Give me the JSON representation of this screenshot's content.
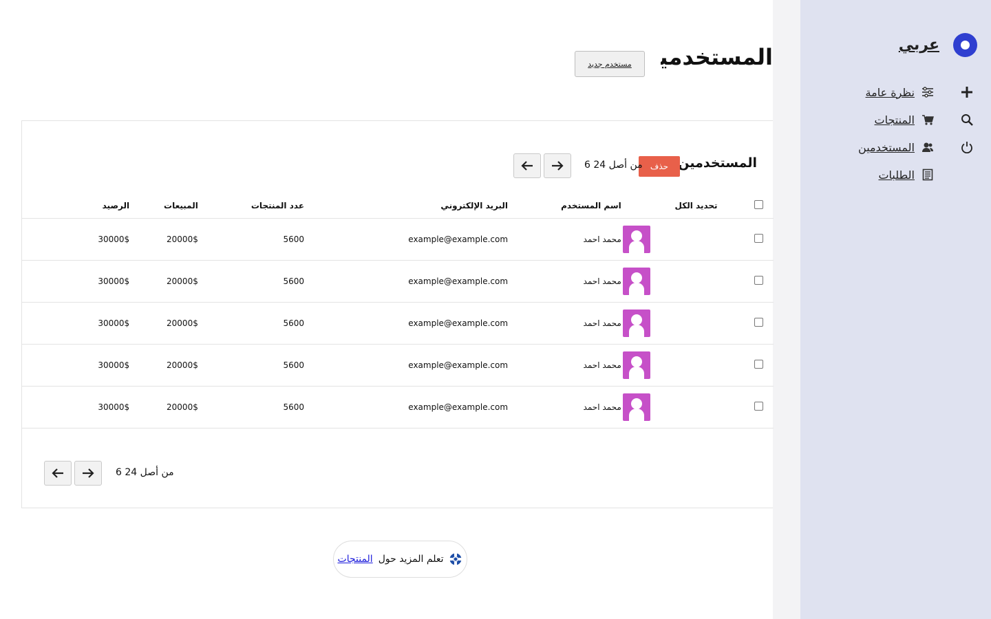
{
  "brand": {
    "name": "عربي",
    "accent": "#2f3fd0"
  },
  "sidebar": {
    "items": [
      {
        "label": "نظرة عامة",
        "icon": "sliders-icon"
      },
      {
        "label": "المنتجات",
        "icon": "cart-icon"
      },
      {
        "label": "المستخدمين",
        "icon": "users-icon"
      },
      {
        "label": "الطلبات",
        "icon": "document-icon"
      }
    ],
    "actions": [
      "plus-icon",
      "search-icon",
      "power-icon"
    ]
  },
  "header": {
    "title": "المستخدمين",
    "new_user_label": "مستخدم جديد"
  },
  "card": {
    "title": "المستخدمين",
    "delete_label": "حذف",
    "pager_text": "6 من أصل 24"
  },
  "table": {
    "headers": {
      "select_all": "تحديد الكل",
      "username": "اسم المستخدم",
      "email": "البريد الإلكتروني",
      "products": "عدد المنتجات",
      "sales": "المبيعات",
      "balance": "الرصيد"
    },
    "rows": [
      {
        "username": "محمد احمد",
        "email": "example@example.com",
        "products": "5600",
        "sales": "20000$",
        "balance": "30000$"
      },
      {
        "username": "محمد احمد",
        "email": "example@example.com",
        "products": "5600",
        "sales": "20000$",
        "balance": "30000$"
      },
      {
        "username": "محمد احمد",
        "email": "example@example.com",
        "products": "5600",
        "sales": "20000$",
        "balance": "30000$"
      },
      {
        "username": "محمد احمد",
        "email": "example@example.com",
        "products": "5600",
        "sales": "20000$",
        "balance": "30000$"
      },
      {
        "username": "محمد احمد",
        "email": "example@example.com",
        "products": "5600",
        "sales": "20000$",
        "balance": "30000$"
      }
    ]
  },
  "bottom_pager_text": "6 من أصل 24",
  "learn_more": {
    "text": "تعلم المزيد حول",
    "link": "المنتجات"
  },
  "colors": {
    "sidebar_bg": "#dfe2f0",
    "delete": "#e8604a",
    "avatar": "#c650c8"
  }
}
